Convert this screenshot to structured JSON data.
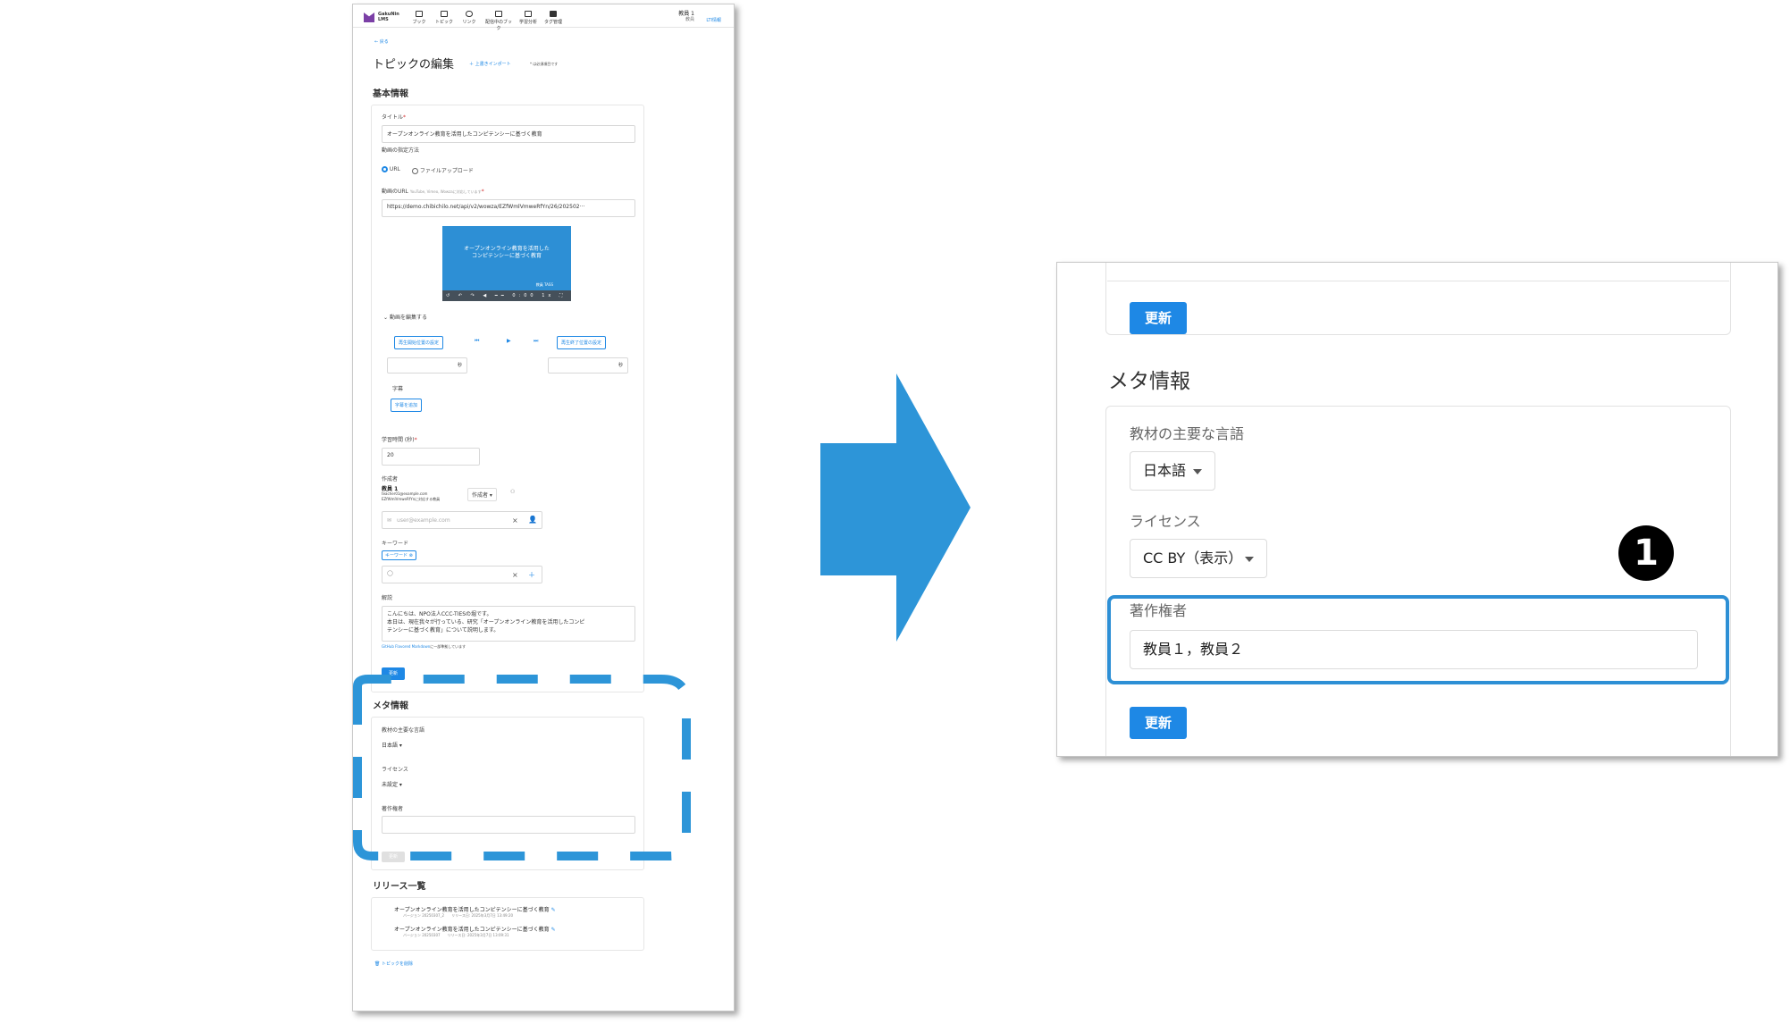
{
  "left": {
    "header": {
      "logo_line1": "GakuNin",
      "logo_line2": "LMS",
      "nav": [
        "ブック",
        "トピック",
        "リンク",
        "配信中のブック",
        "学習分析",
        "タグ管理"
      ],
      "user_name": "教員 1",
      "user_role": "教員",
      "lti_info": "LTI情報"
    },
    "back": "戻る",
    "page_title": "トピックの編集",
    "import_link": "上書きインポート",
    "required_note": "* は必須項目です",
    "basic_section": "基本情報",
    "title_label": "タイトル",
    "title_value": "オープンオンライン教育を活用したコンピテンシーに基づく教育",
    "video_method_label": "動画の指定方法",
    "radio_url": "URL",
    "radio_upload": "ファイルアップロード",
    "video_url_label": "動画のURL",
    "video_url_hint": "YouTube, Vimeo, Wowzaに対応しています",
    "video_url_value": "https://demo.chibichilo.net/api/v2/wowza/EZfWmlVmweRfYn/26/202502···",
    "video_title_line1": "オープンオンライン教育を活用した",
    "video_title_line2": "コンピテンシーに基づく教育",
    "video_speaker": "教員 TASS",
    "video_controls": "↺ ↶ ↷ ◀ ━━ 0:00 1x ⛶",
    "edit_video": "動画を編集する",
    "start_btn": "再生開始位置の設定",
    "end_btn": "再生終了位置の設定",
    "sec_unit": "秒",
    "subtitle_label": "字幕",
    "subtitle_btn": "字幕を追加",
    "duration_label": "学習時間 (秒)",
    "duration_value": "20",
    "author_label": "作成者",
    "author_name": "教員 1",
    "author_email": "teacher01@example.com",
    "author_note": "EZfWmlVmweRfYnに対応する教員",
    "author_role": "作成者",
    "author_input_placeholder": "user@example.com",
    "keyword_label": "キーワード",
    "keyword_chip": "キーワード ⊗",
    "desc_label": "解説",
    "desc_line1": "こんにちは、NPO法人CCC-TIESの堀です。",
    "desc_line2": "本日は、現在我々が行っている、研究「オープンオンライン教育を活用したコンピ",
    "desc_line3": "テンシーに基づく教育」について説明します。",
    "markdown_note_link": "GitHub Flavored Markdown",
    "markdown_note_rest": "に一部準拠しています",
    "update_btn": "更新",
    "meta_section": "メタ情報",
    "lang_label": "教材の主要な言語",
    "lang_value": "日本語",
    "license_label": "ライセンス",
    "license_value": "未設定",
    "rights_label": "著作権者",
    "release_section": "リリース一覧",
    "releases": [
      {
        "title": "オープンオンライン教育を活用したコンピテンシーに基づく教育",
        "version": "バージョン 20250307_2",
        "date": "リリース日: 2025年3月7日 13:49:20"
      },
      {
        "title": "オープンオンライン教育を活用したコンピテンシーに基づく教育",
        "version": "バージョン 20250307",
        "date": "リリース日: 2025年3月7日 13:09:31"
      }
    ],
    "delete_link": "トピックを削除"
  },
  "zoom": {
    "update_btn": "更新",
    "meta_title": "メタ情報",
    "lang_label": "教材の主要な言語",
    "lang_value": "日本語",
    "license_label": "ライセンス",
    "license_value": "CC BY（表示）",
    "rights_label": "著作権者",
    "rights_value": "教員１，教員２",
    "update_btn2": "更新"
  },
  "badge": "1",
  "colors": {
    "accent": "#1e88e5",
    "highlight": "#2d8fd5",
    "arrow": "#2d95d8"
  }
}
